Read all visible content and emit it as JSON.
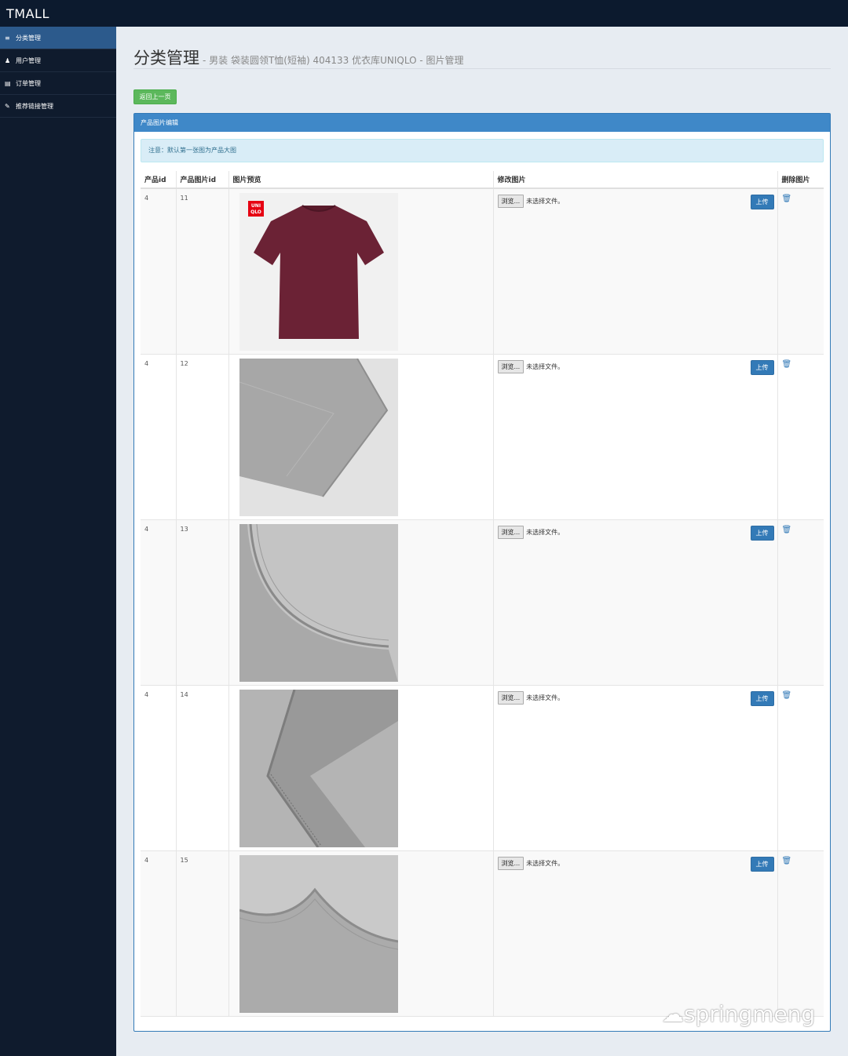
{
  "app": {
    "brand": "TMALL"
  },
  "sidebar": {
    "items": [
      {
        "icon": "list-icon",
        "glyph": "≡",
        "label": "分类管理"
      },
      {
        "icon": "user-icon",
        "glyph": "♟",
        "label": "用户管理"
      },
      {
        "icon": "order-list-icon",
        "glyph": "▤",
        "label": "订单管理"
      },
      {
        "icon": "link-icon",
        "glyph": "✎",
        "label": "推荐链接管理"
      }
    ]
  },
  "header": {
    "title": "分类管理",
    "subtitle": "- 男装 袋装圆领T恤(短袖) 404133 优衣库UNIQLO - 图片管理"
  },
  "back_button": "返回上一页",
  "panel": {
    "title": "产品图片编辑",
    "notice": "注意：默认第一张图为产品大图"
  },
  "table": {
    "headers": [
      "产品id",
      "产品图片id",
      "图片预览",
      "修改图片",
      "删除图片"
    ],
    "browse_label": "浏览...",
    "no_file_label": "未选择文件。",
    "upload_label": "上传",
    "rows": [
      {
        "product_id": "4",
        "image_id": "11",
        "image": "maroon-tshirt"
      },
      {
        "product_id": "4",
        "image_id": "12",
        "image": "grey-sleeve"
      },
      {
        "product_id": "4",
        "image_id": "13",
        "image": "grey-collar"
      },
      {
        "product_id": "4",
        "image_id": "14",
        "image": "grey-seam"
      },
      {
        "product_id": "4",
        "image_id": "15",
        "image": "grey-neck"
      }
    ]
  },
  "colors": {
    "navbar": "#0c1a2e",
    "sidebar_active": "#2c5a8c",
    "success": "#5cb85c",
    "primary": "#337ab7",
    "tshirt": "#6b2235"
  },
  "watermark": "springmeng"
}
